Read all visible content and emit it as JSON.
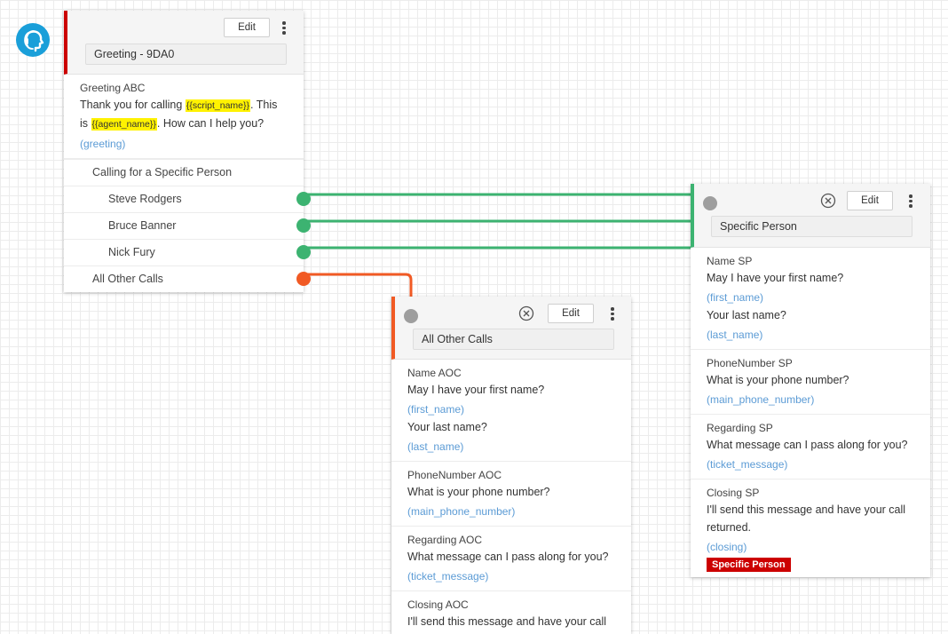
{
  "edit_label": "Edit",
  "colors": {
    "green": "#3cb371",
    "orange": "#f15a24",
    "red": "#cc0000",
    "accent_blue": "#1a9fd9",
    "variable_blue": "#5b9bd5",
    "highlight": "#fff200"
  },
  "greeting_card": {
    "title": "Greeting - 9DA0",
    "section_title": "Greeting ABC",
    "text_part1": "Thank you for calling ",
    "var_script_name": "{{script_name}}",
    "text_part2": ". This is ",
    "var_agent_name": "{{agent_name}}",
    "text_part3": ". How can I help you?",
    "variable": "(greeting)",
    "branch_group": "Calling for a Specific Person",
    "branches": [
      "Steve Rodgers",
      "Bruce Banner",
      "Nick Fury"
    ],
    "other_branch": "All Other Calls"
  },
  "specific_card": {
    "title": "Specific Person",
    "sections": [
      {
        "title": "Name SP",
        "text": "May I have your first name?",
        "var": "(first_name)",
        "text2": "Your last name?",
        "var2": "(last_name)"
      },
      {
        "title": "PhoneNumber SP",
        "text": "What is your phone number?",
        "var": "(main_phone_number)"
      },
      {
        "title": "Regarding SP",
        "text": "What message can I pass along for you?",
        "var": "(ticket_message)"
      },
      {
        "title": "Closing SP",
        "text": "I'll send this message and have your call returned.",
        "var": "(closing)",
        "tag": "Specific Person"
      }
    ]
  },
  "other_card": {
    "title": "All Other Calls",
    "sections": [
      {
        "title": "Name AOC",
        "text": "May I have your first name?",
        "var": "(first_name)",
        "text2": "Your last name?",
        "var2": "(last_name)"
      },
      {
        "title": "PhoneNumber AOC",
        "text": "What is your phone number?",
        "var": "(main_phone_number)"
      },
      {
        "title": "Regarding AOC",
        "text": "What message can I pass along for you?",
        "var": "(ticket_message)"
      },
      {
        "title": "Closing AOC",
        "text": "I'll send this message and have your call"
      }
    ]
  }
}
